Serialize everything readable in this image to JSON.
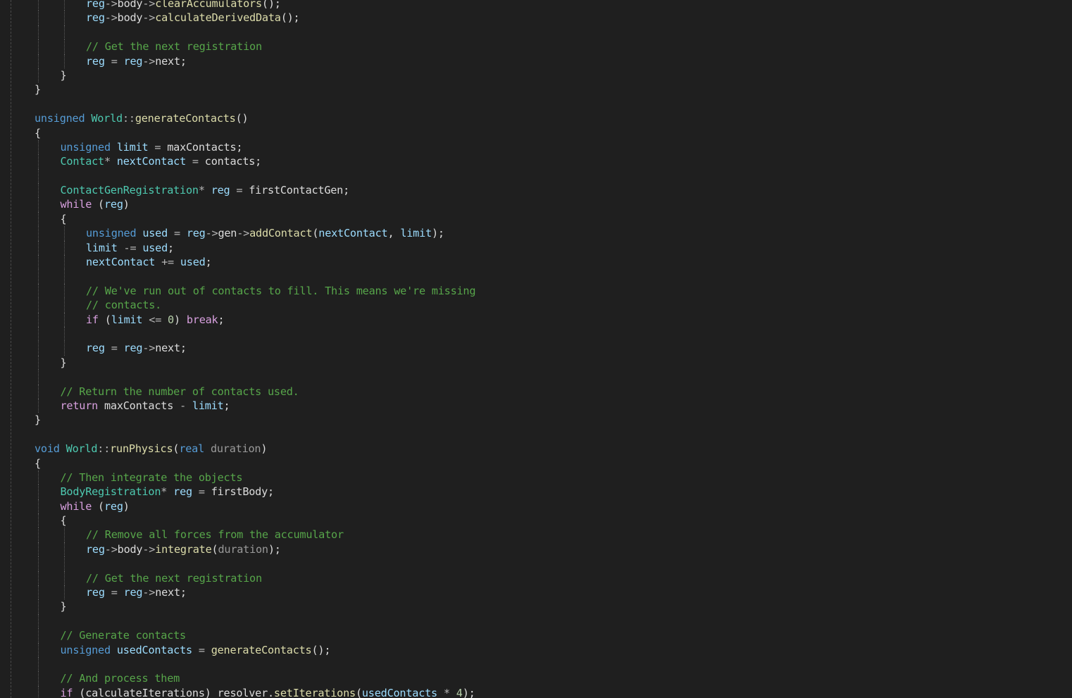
{
  "editor": {
    "language": "C++",
    "theme_colors": {
      "background": "#1f1f1f",
      "plain": "#dcdcdc",
      "keyword": "#569cd6",
      "control": "#d8a0df",
      "type": "#4ec9b0",
      "function": "#dcdcaa",
      "variable": "#9cdcfe",
      "parameter": "#9a9a9a",
      "comment": "#57a64a",
      "number": "#b5cea8",
      "operator": "#b4b4b4"
    },
    "lines": [
      {
        "indent": 2,
        "tokens": [
          [
            "var",
            "reg"
          ],
          [
            "op",
            "->"
          ],
          [
            "pl",
            "body"
          ],
          [
            "op",
            "->"
          ],
          [
            "fn",
            "clearAccumulators"
          ],
          [
            "pl",
            "();"
          ]
        ]
      },
      {
        "indent": 2,
        "tokens": [
          [
            "var",
            "reg"
          ],
          [
            "op",
            "->"
          ],
          [
            "pl",
            "body"
          ],
          [
            "op",
            "->"
          ],
          [
            "fn",
            "calculateDerivedData"
          ],
          [
            "pl",
            "();"
          ]
        ]
      },
      {
        "indent": 2,
        "tokens": []
      },
      {
        "indent": 2,
        "tokens": [
          [
            "cm",
            "// Get the next registration"
          ]
        ]
      },
      {
        "indent": 2,
        "tokens": [
          [
            "var",
            "reg"
          ],
          [
            "op",
            " = "
          ],
          [
            "var",
            "reg"
          ],
          [
            "op",
            "->"
          ],
          [
            "pl",
            "next;"
          ]
        ]
      },
      {
        "indent": 1,
        "tokens": [
          [
            "pl",
            "}"
          ]
        ]
      },
      {
        "indent": 0,
        "tokens": [
          [
            "pl",
            "}"
          ]
        ]
      },
      {
        "indent": 0,
        "tokens": []
      },
      {
        "indent": 0,
        "tokens": [
          [
            "kw",
            "unsigned"
          ],
          [
            "pl",
            " "
          ],
          [
            "ty",
            "World"
          ],
          [
            "op",
            "::"
          ],
          [
            "fn",
            "generateContacts"
          ],
          [
            "pl",
            "()"
          ]
        ]
      },
      {
        "indent": 0,
        "tokens": [
          [
            "pl",
            "{"
          ]
        ]
      },
      {
        "indent": 1,
        "tokens": [
          [
            "kw",
            "unsigned"
          ],
          [
            "pl",
            " "
          ],
          [
            "var",
            "limit"
          ],
          [
            "op",
            " = "
          ],
          [
            "pl",
            "maxContacts;"
          ]
        ]
      },
      {
        "indent": 1,
        "tokens": [
          [
            "ty",
            "Contact"
          ],
          [
            "op",
            "* "
          ],
          [
            "var",
            "nextContact"
          ],
          [
            "op",
            " = "
          ],
          [
            "pl",
            "contacts;"
          ]
        ]
      },
      {
        "indent": 1,
        "tokens": []
      },
      {
        "indent": 1,
        "tokens": [
          [
            "ty",
            "ContactGenRegistration"
          ],
          [
            "op",
            "* "
          ],
          [
            "var",
            "reg"
          ],
          [
            "op",
            " = "
          ],
          [
            "pl",
            "firstContactGen;"
          ]
        ]
      },
      {
        "indent": 1,
        "tokens": [
          [
            "ctl",
            "while"
          ],
          [
            "pl",
            " ("
          ],
          [
            "var",
            "reg"
          ],
          [
            "pl",
            ")"
          ]
        ]
      },
      {
        "indent": 1,
        "tokens": [
          [
            "pl",
            "{"
          ]
        ]
      },
      {
        "indent": 2,
        "tokens": [
          [
            "kw",
            "unsigned"
          ],
          [
            "pl",
            " "
          ],
          [
            "var",
            "used"
          ],
          [
            "op",
            " = "
          ],
          [
            "var",
            "reg"
          ],
          [
            "op",
            "->"
          ],
          [
            "pl",
            "gen"
          ],
          [
            "op",
            "->"
          ],
          [
            "fn",
            "addContact"
          ],
          [
            "pl",
            "("
          ],
          [
            "var",
            "nextContact"
          ],
          [
            "pl",
            ", "
          ],
          [
            "var",
            "limit"
          ],
          [
            "pl",
            ");"
          ]
        ]
      },
      {
        "indent": 2,
        "tokens": [
          [
            "var",
            "limit"
          ],
          [
            "op",
            " -= "
          ],
          [
            "var",
            "used"
          ],
          [
            "pl",
            ";"
          ]
        ]
      },
      {
        "indent": 2,
        "tokens": [
          [
            "var",
            "nextContact"
          ],
          [
            "op",
            " += "
          ],
          [
            "var",
            "used"
          ],
          [
            "pl",
            ";"
          ]
        ]
      },
      {
        "indent": 2,
        "tokens": []
      },
      {
        "indent": 2,
        "tokens": [
          [
            "cm",
            "// We've run out of contacts to fill. This means we're missing"
          ]
        ]
      },
      {
        "indent": 2,
        "tokens": [
          [
            "cm",
            "// contacts."
          ]
        ]
      },
      {
        "indent": 2,
        "tokens": [
          [
            "ctl",
            "if"
          ],
          [
            "pl",
            " ("
          ],
          [
            "var",
            "limit"
          ],
          [
            "op",
            " <= "
          ],
          [
            "num",
            "0"
          ],
          [
            "pl",
            ") "
          ],
          [
            "ctl",
            "break"
          ],
          [
            "pl",
            ";"
          ]
        ]
      },
      {
        "indent": 2,
        "tokens": []
      },
      {
        "indent": 2,
        "tokens": [
          [
            "var",
            "reg"
          ],
          [
            "op",
            " = "
          ],
          [
            "var",
            "reg"
          ],
          [
            "op",
            "->"
          ],
          [
            "pl",
            "next;"
          ]
        ]
      },
      {
        "indent": 1,
        "tokens": [
          [
            "pl",
            "}"
          ]
        ]
      },
      {
        "indent": 1,
        "tokens": []
      },
      {
        "indent": 1,
        "tokens": [
          [
            "cm",
            "// Return the number of contacts used."
          ]
        ]
      },
      {
        "indent": 1,
        "tokens": [
          [
            "ctl",
            "return"
          ],
          [
            "pl",
            " maxContacts"
          ],
          [
            "op",
            " - "
          ],
          [
            "var",
            "limit"
          ],
          [
            "pl",
            ";"
          ]
        ]
      },
      {
        "indent": 0,
        "tokens": [
          [
            "pl",
            "}"
          ]
        ]
      },
      {
        "indent": 0,
        "tokens": []
      },
      {
        "indent": 0,
        "tokens": [
          [
            "kw",
            "void"
          ],
          [
            "pl",
            " "
          ],
          [
            "ty",
            "World"
          ],
          [
            "op",
            "::"
          ],
          [
            "fn",
            "runPhysics"
          ],
          [
            "pl",
            "("
          ],
          [
            "kw",
            "real"
          ],
          [
            "pl",
            " "
          ],
          [
            "par",
            "duration"
          ],
          [
            "pl",
            ")"
          ]
        ]
      },
      {
        "indent": 0,
        "tokens": [
          [
            "pl",
            "{"
          ]
        ]
      },
      {
        "indent": 1,
        "tokens": [
          [
            "cm",
            "// Then integrate the objects"
          ]
        ]
      },
      {
        "indent": 1,
        "tokens": [
          [
            "ty",
            "BodyRegistration"
          ],
          [
            "op",
            "* "
          ],
          [
            "var",
            "reg"
          ],
          [
            "op",
            " = "
          ],
          [
            "pl",
            "firstBody;"
          ]
        ]
      },
      {
        "indent": 1,
        "tokens": [
          [
            "ctl",
            "while"
          ],
          [
            "pl",
            " ("
          ],
          [
            "var",
            "reg"
          ],
          [
            "pl",
            ")"
          ]
        ]
      },
      {
        "indent": 1,
        "tokens": [
          [
            "pl",
            "{"
          ]
        ]
      },
      {
        "indent": 2,
        "tokens": [
          [
            "cm",
            "// Remove all forces from the accumulator"
          ]
        ]
      },
      {
        "indent": 2,
        "tokens": [
          [
            "var",
            "reg"
          ],
          [
            "op",
            "->"
          ],
          [
            "pl",
            "body"
          ],
          [
            "op",
            "->"
          ],
          [
            "fn",
            "integrate"
          ],
          [
            "pl",
            "("
          ],
          [
            "par",
            "duration"
          ],
          [
            "pl",
            ");"
          ]
        ]
      },
      {
        "indent": 2,
        "tokens": []
      },
      {
        "indent": 2,
        "tokens": [
          [
            "cm",
            "// Get the next registration"
          ]
        ]
      },
      {
        "indent": 2,
        "tokens": [
          [
            "var",
            "reg"
          ],
          [
            "op",
            " = "
          ],
          [
            "var",
            "reg"
          ],
          [
            "op",
            "->"
          ],
          [
            "pl",
            "next;"
          ]
        ]
      },
      {
        "indent": 1,
        "tokens": [
          [
            "pl",
            "}"
          ]
        ]
      },
      {
        "indent": 1,
        "tokens": []
      },
      {
        "indent": 1,
        "tokens": [
          [
            "cm",
            "// Generate contacts"
          ]
        ]
      },
      {
        "indent": 1,
        "tokens": [
          [
            "kw",
            "unsigned"
          ],
          [
            "pl",
            " "
          ],
          [
            "var",
            "usedContacts"
          ],
          [
            "op",
            " = "
          ],
          [
            "fn",
            "generateContacts"
          ],
          [
            "pl",
            "();"
          ]
        ]
      },
      {
        "indent": 1,
        "tokens": []
      },
      {
        "indent": 1,
        "tokens": [
          [
            "cm",
            "// And process them"
          ]
        ]
      },
      {
        "indent": 1,
        "tokens": [
          [
            "ctl",
            "if"
          ],
          [
            "pl",
            " (calculateIterations) resolver."
          ],
          [
            "fn",
            "setIterations"
          ],
          [
            "pl",
            "("
          ],
          [
            "var",
            "usedContacts"
          ],
          [
            "op",
            " * "
          ],
          [
            "num",
            "4"
          ],
          [
            "pl",
            ");"
          ]
        ]
      }
    ]
  }
}
